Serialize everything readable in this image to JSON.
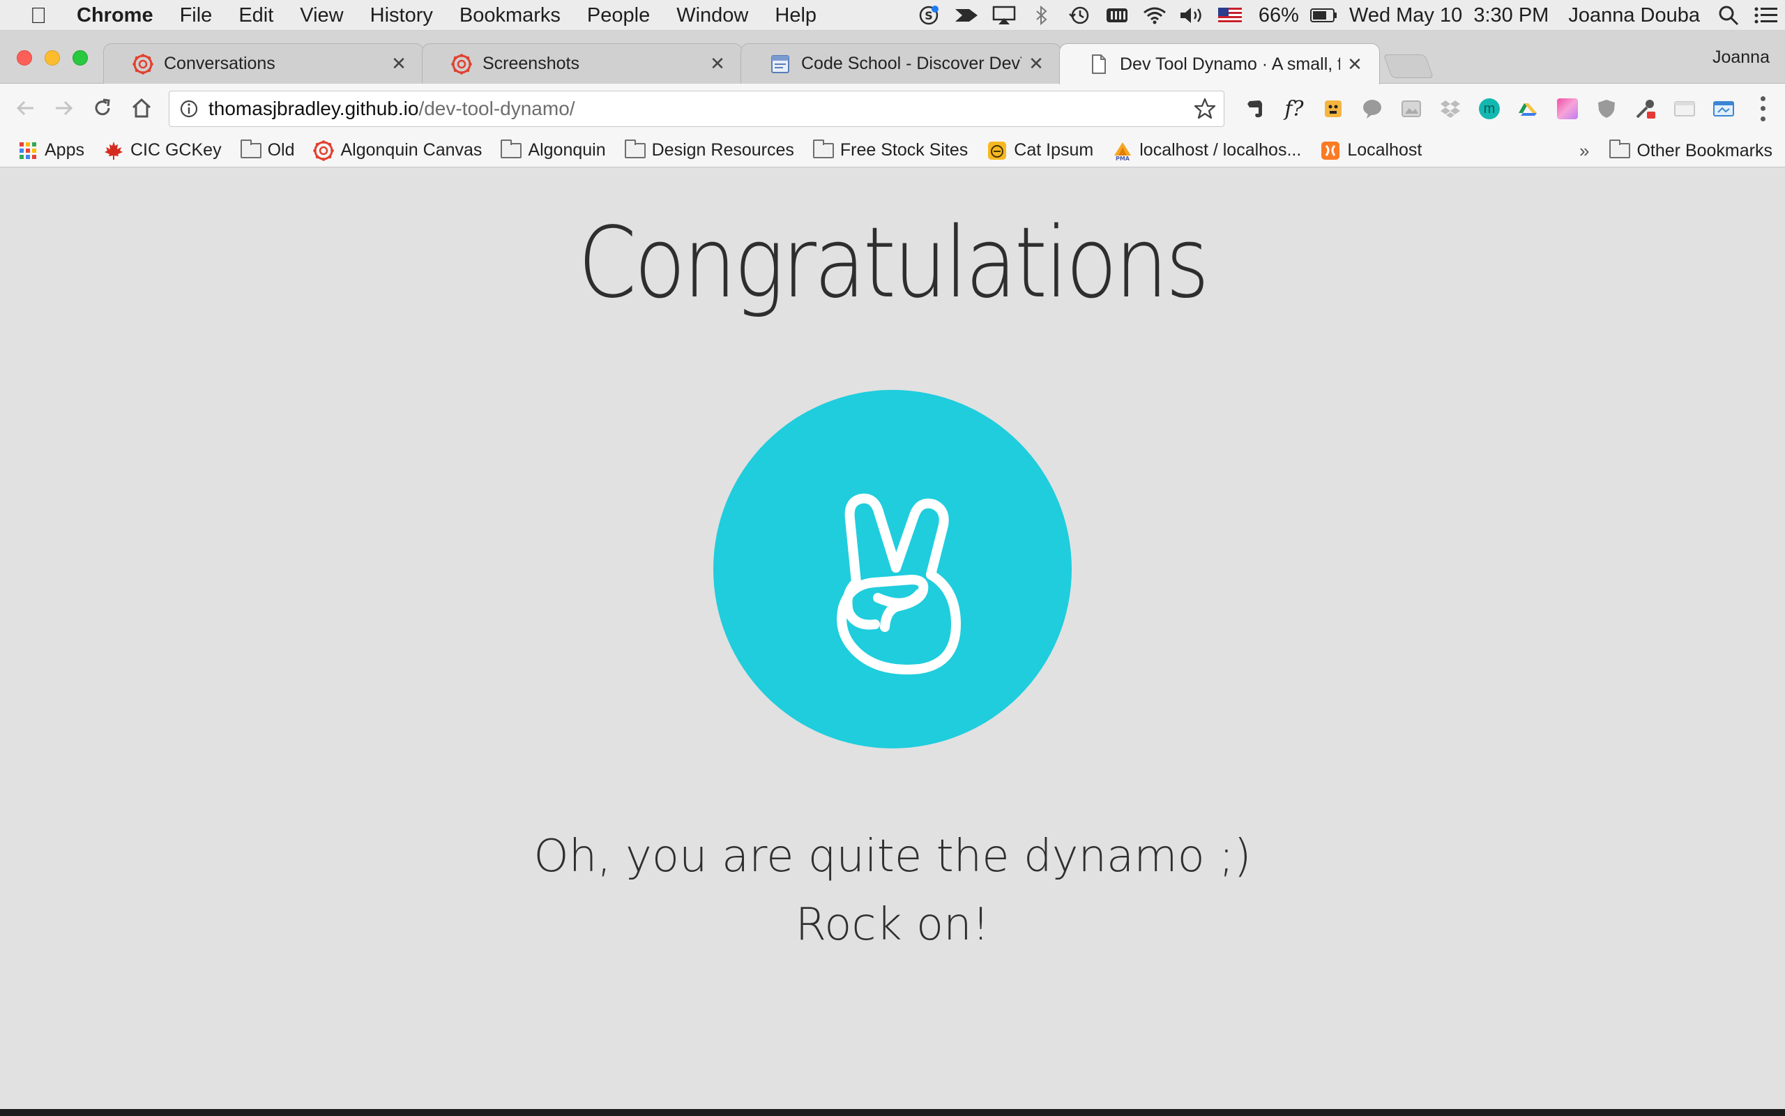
{
  "menubar": {
    "app_name": "Chrome",
    "menus": [
      "File",
      "Edit",
      "View",
      "History",
      "Bookmarks",
      "People",
      "Window",
      "Help"
    ],
    "battery": "66%",
    "datetime": "Wed May 10  3:30 PM",
    "user": "Joanna Douba"
  },
  "tabs": [
    {
      "title": "Conversations",
      "favicon": "canvas-icon",
      "active": false
    },
    {
      "title": "Screenshots",
      "favicon": "canvas-icon",
      "active": false
    },
    {
      "title": "Code School - Discover DevTo",
      "favicon": "page-layout-icon",
      "active": false
    },
    {
      "title": "Dev Tool Dynamo · A small, fur",
      "favicon": "document-icon",
      "active": true
    }
  ],
  "profile_name": "Joanna",
  "address": {
    "host": "thomasjbradley.github.io",
    "path": "/dev-tool-dynamo/"
  },
  "bookmarks": [
    {
      "label": "Apps",
      "icon": "apps-grid-icon"
    },
    {
      "label": "CIC GCKey",
      "icon": "maple-leaf-icon"
    },
    {
      "label": "Old",
      "icon": "folder-icon"
    },
    {
      "label": "Algonquin Canvas",
      "icon": "canvas-icon"
    },
    {
      "label": "Algonquin",
      "icon": "folder-icon"
    },
    {
      "label": "Design Resources",
      "icon": "folder-icon"
    },
    {
      "label": "Free Stock Sites",
      "icon": "folder-icon"
    },
    {
      "label": "Cat Ipsum",
      "icon": "cat-icon"
    },
    {
      "label": "localhost / localhos...",
      "icon": "phpmyadmin-icon"
    },
    {
      "label": "Localhost",
      "icon": "xampp-icon"
    }
  ],
  "other_bookmarks": "Other Bookmarks",
  "page": {
    "heading": "Congratulations",
    "line1": "Oh, you are quite the dynamo ;)",
    "line2": "Rock on!",
    "badge_color": "#1fcddd",
    "badge_icon": "peace-hand-icon"
  },
  "colors": {
    "page_background": "#e1e1e1",
    "accent": "#1fcddd"
  }
}
